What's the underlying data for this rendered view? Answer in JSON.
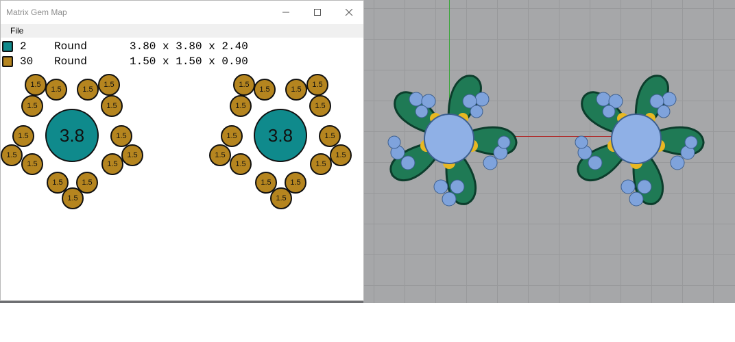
{
  "window": {
    "title": "Matrix Gem Map"
  },
  "menu": {
    "file": "File"
  },
  "gems": [
    {
      "count": "2",
      "shape": "Round",
      "dims": "3.80 x 3.80 x 2.40",
      "color": "#0f8a8c"
    },
    {
      "count": "30",
      "shape": "Round",
      "dims": "1.50 x 1.50 x 0.90",
      "color": "#b5851f"
    }
  ],
  "map": {
    "large_label": "3.8",
    "small_label": "1.5"
  },
  "colors": {
    "teal": "#0f8a8c",
    "gold": "#b5851f",
    "grid_bg": "#a6a7a9"
  }
}
